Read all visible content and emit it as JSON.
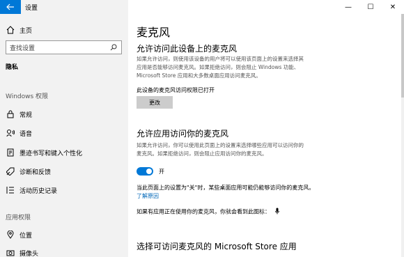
{
  "window": {
    "app_title": "设置",
    "back_icon": "arrow-left-icon",
    "controls": [
      "minimize-icon",
      "maximize-icon",
      "close-icon"
    ]
  },
  "sidebar": {
    "home_label": "主页",
    "search_placeholder": "查找设置",
    "privacy_heading": "隐私",
    "windows_section": "Windows 权限",
    "windows_items": [
      {
        "label": "常规",
        "icon": "lock-icon"
      },
      {
        "label": "语音",
        "icon": "speech-icon"
      },
      {
        "label": "墨迹书写和键入个性化",
        "icon": "pen-keyboard-icon"
      },
      {
        "label": "诊断和反馈",
        "icon": "feedback-icon"
      },
      {
        "label": "活动历史记录",
        "icon": "timeline-icon"
      }
    ],
    "app_section": "应用权限",
    "app_items": [
      {
        "label": "位置",
        "icon": "location-icon"
      },
      {
        "label": "摄像头",
        "icon": "camera-icon"
      }
    ]
  },
  "main": {
    "title": "麦克风",
    "section1": {
      "heading": "允许访问此设备上的麦克风",
      "description_lines": [
        "如果允许访问，则使用该设备的用户将可以使用该页面上的设置来选择其",
        "应用是否能够访问麦克风。如果拒绝访问，则会阻止 Windows 功能、",
        "Microsoft Store 应用和大多数桌面应用访问麦克风。"
      ],
      "status": "此设备的麦克风访问权限已打开",
      "button": "更改"
    },
    "section2": {
      "heading": "允许应用访问你的麦克风",
      "description_lines": [
        "如果允许访问，你可以使用此页面上的设置来选择哪些应用可以访问你的",
        "麦克风。如果拒绝访问，则会阻止应用访问你的麦克风。"
      ],
      "toggle_state": "开",
      "note": "当此页面上的设置为\"关\"时，某些桌面应用可能仍能够访问你的麦克风。",
      "link": "了解原因",
      "mic_hint": "如果有应用正在使用你的麦克风，你就会看到此图标："
    },
    "section3": {
      "heading": "选择可访问麦克风的 Microsoft Store 应用"
    }
  }
}
